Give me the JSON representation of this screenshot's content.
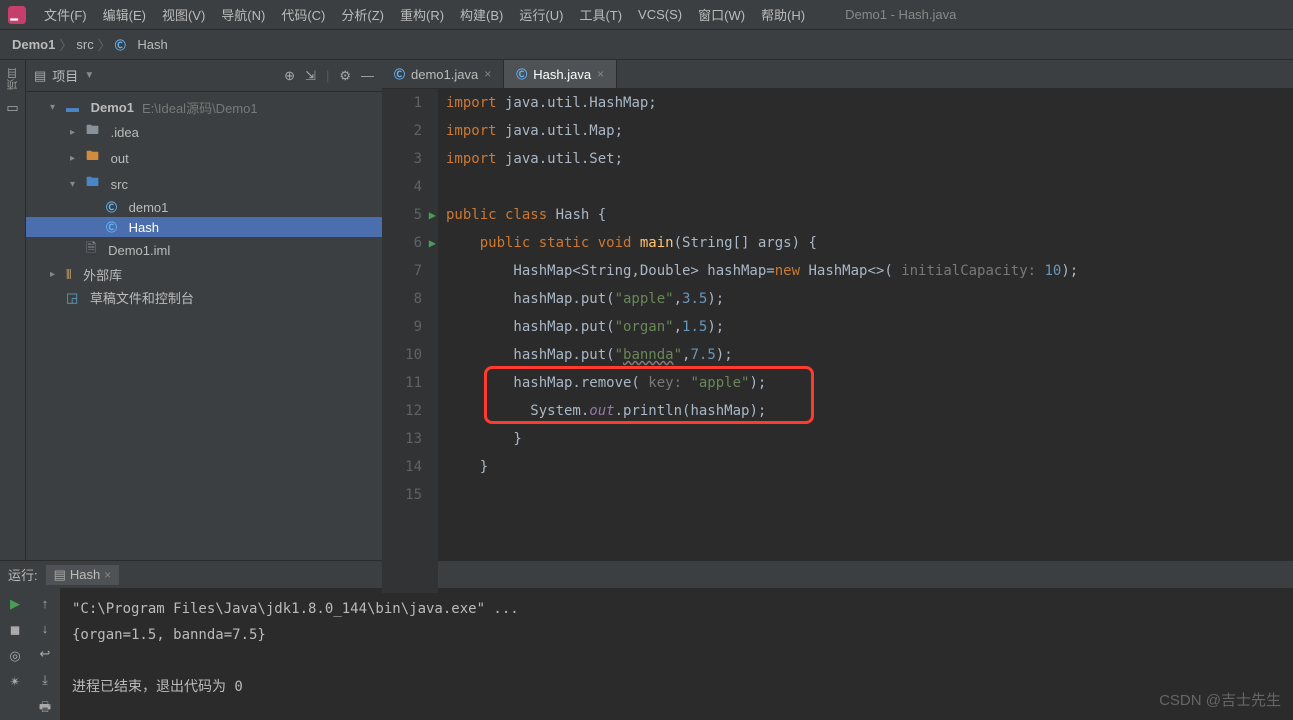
{
  "menu": {
    "items": [
      "文件(F)",
      "编辑(E)",
      "视图(V)",
      "导航(N)",
      "代码(C)",
      "分析(Z)",
      "重构(R)",
      "构建(B)",
      "运行(U)",
      "工具(T)",
      "VCS(S)",
      "窗口(W)",
      "帮助(H)"
    ]
  },
  "window_title": "Demo1 - Hash.java",
  "breadcrumb": {
    "root": "Demo1",
    "src": "src",
    "file": "Hash"
  },
  "leftbar": {
    "project": "项目"
  },
  "sidebar": {
    "title": "项目",
    "tree": [
      {
        "t": "Demo1",
        "sub": "E:\\Ideal源码\\Demo1"
      },
      {
        "t": ".idea"
      },
      {
        "t": "out"
      },
      {
        "t": "src"
      },
      {
        "t": "demo1"
      },
      {
        "t": "Hash"
      },
      {
        "t": "Demo1.iml"
      },
      {
        "t": "外部库"
      },
      {
        "t": "草稿文件和控制台"
      }
    ]
  },
  "tabs": [
    {
      "label": "demo1.java",
      "active": false
    },
    {
      "label": "Hash.java",
      "active": true
    }
  ],
  "code": {
    "lines": [
      {
        "n": 1,
        "html": "import java.util.HashMap;"
      },
      {
        "n": 2,
        "html": "import java.util.Map;"
      },
      {
        "n": 3,
        "html": "import java.util.Set;"
      },
      {
        "n": 4,
        "html": ""
      },
      {
        "n": 5,
        "html": "public class Hash {",
        "run": true
      },
      {
        "n": 6,
        "html": "    public static void main(String[] args) {",
        "run": true
      },
      {
        "n": 7,
        "html": "        HashMap<String,Double> hashMap=new HashMap<>( initialCapacity: 10);"
      },
      {
        "n": 8,
        "html": "        hashMap.put(\"apple\",3.5);"
      },
      {
        "n": 9,
        "html": "        hashMap.put(\"organ\",1.5);"
      },
      {
        "n": 10,
        "html": "        hashMap.put(\"bannda\",7.5);"
      },
      {
        "n": 11,
        "html": "        hashMap.remove( key: \"apple\");"
      },
      {
        "n": 12,
        "html": "          System.out.println(hashMap);"
      },
      {
        "n": 13,
        "html": "        }"
      },
      {
        "n": 14,
        "html": "    }"
      },
      {
        "n": 15,
        "html": ""
      }
    ]
  },
  "run": {
    "label": "运行:",
    "tab": "Hash",
    "out1": "\"C:\\Program Files\\Java\\jdk1.8.0_144\\bin\\java.exe\" ...",
    "out2": "{organ=1.5, bannda=7.5}",
    "out3": "进程已结束，退出代码为 0"
  },
  "watermark": "CSDN @吉士先生"
}
